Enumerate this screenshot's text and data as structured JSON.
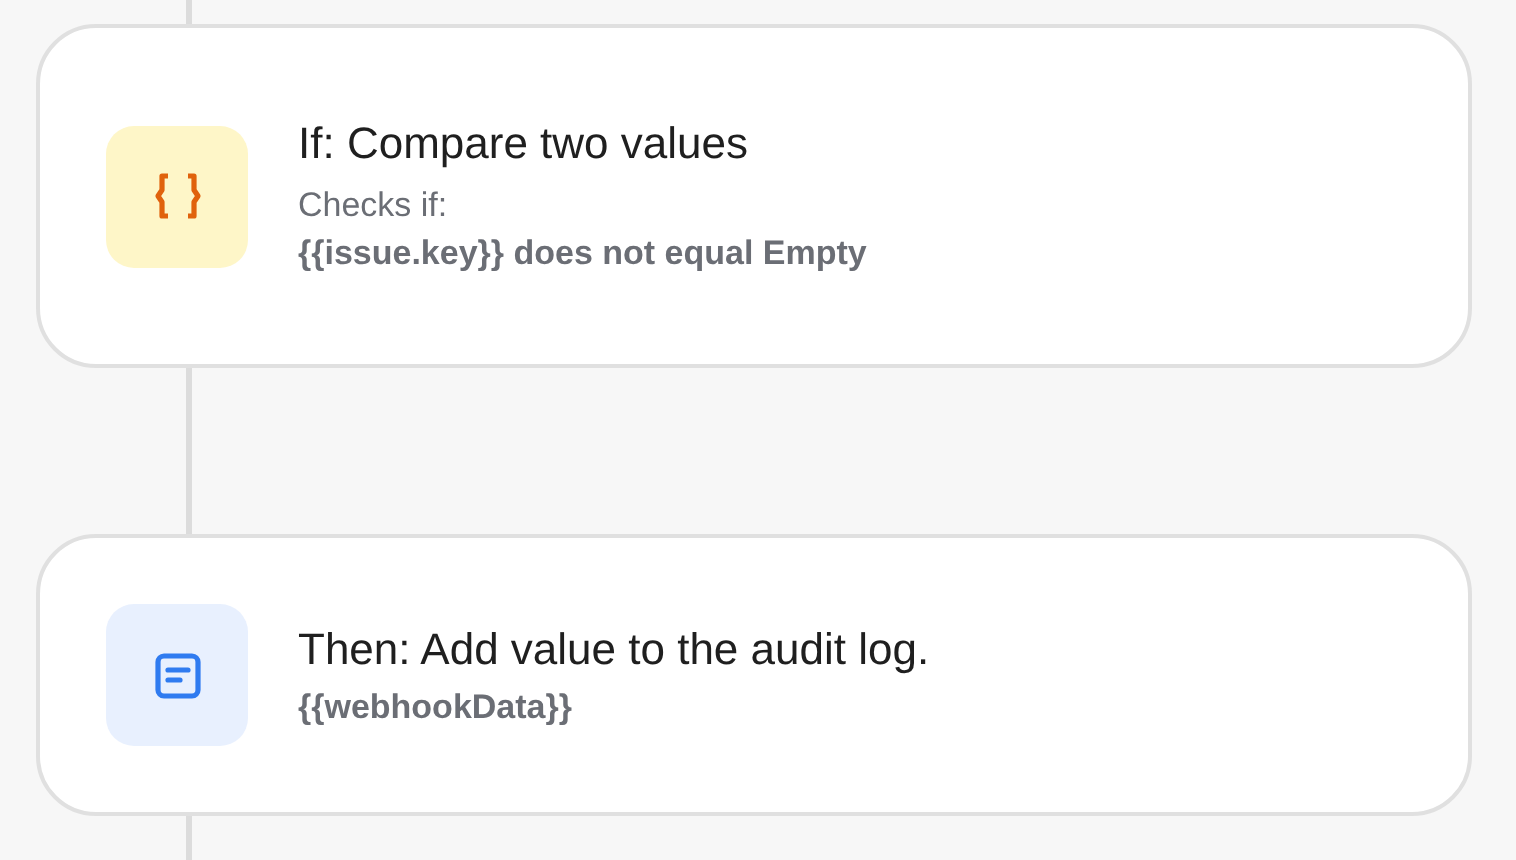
{
  "steps": [
    {
      "kind": "condition",
      "title": "If: Compare two values",
      "caption": "Checks if:",
      "detail": "{{issue.key}} does not equal Empty"
    },
    {
      "kind": "action",
      "title": "Then: Add value to the audit log.",
      "detail": "{{webhookData}}"
    }
  ]
}
